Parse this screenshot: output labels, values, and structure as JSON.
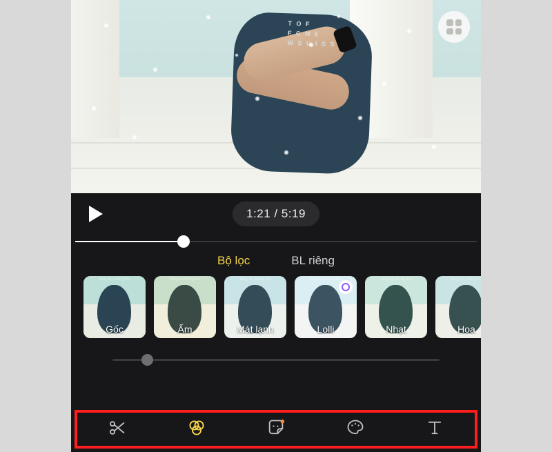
{
  "preview": {
    "shirt_lines": [
      "T O F",
      "F C M 6",
      "W S U I S S"
    ]
  },
  "playback": {
    "time_display": "1:21 / 5:19",
    "progress_pct": 27
  },
  "tabs": {
    "filter": "Bộ lọc",
    "custom": "BL riêng",
    "active": "filter"
  },
  "filters": [
    {
      "id": "goc",
      "label": "Gốc",
      "selected": true,
      "caption": "tổng ơn mừng thế"
    },
    {
      "id": "am",
      "label": "Ấm",
      "selected": false,
      "caption": "tổng ơn mừng thế"
    },
    {
      "id": "matlanh",
      "label": "Mát lạnh",
      "selected": false,
      "caption": "tổng ơn mừng thế"
    },
    {
      "id": "lolli",
      "label": "Lolli",
      "selected": false,
      "badge": true,
      "caption": "tổng ơn mừng thế"
    },
    {
      "id": "nhat",
      "label": "Nhạt",
      "selected": false,
      "caption": "tổng ơn mừng thế"
    },
    {
      "id": "hoa",
      "label": "Hoa",
      "selected": false,
      "caption": "tổng ơn mừng thế"
    }
  ],
  "intensity": {
    "value_pct": 9
  },
  "toolbar": {
    "items": [
      "cut",
      "filters",
      "sticker",
      "draw",
      "text"
    ],
    "active": "filters"
  },
  "colors": {
    "accent": "#f7d64a",
    "highlight_box": "#ff1d1d"
  }
}
